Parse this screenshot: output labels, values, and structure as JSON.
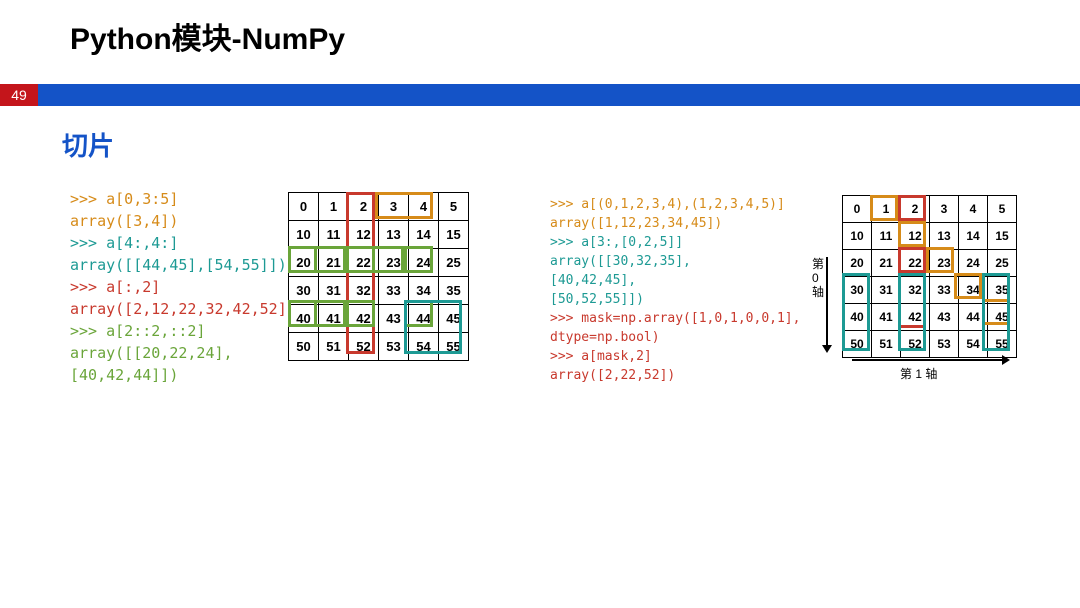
{
  "page_number": "49",
  "title": "Python模块-NumPy",
  "subtitle": "切片",
  "codeL": {
    "l1": ">>> a[0,3:5]",
    "l2": "array([3,4])",
    "l3": ">>> a[4:,4:]",
    "l4": "array([[44,45],[54,55]])",
    "l5": ">>> a[:,2]",
    "l6": "array([2,12,22,32,42,52])",
    "l7": ">>> a[2::2,::2]",
    "l8": "array([[20,22,24],",
    "l9": "       [40,42,44]])"
  },
  "codeR": {
    "l1": ">>> a[(0,1,2,3,4),(1,2,3,4,5)]",
    "l2": "array([1,12,23,34,45])",
    "l3": ">>> a[3:,[0,2,5]]",
    "l4": "array([[30,32,35],",
    "l5": "       [40,42,45],",
    "l6": "       [50,52,55]])",
    "l7": ">>> mask=np.array([1,0,1,0,0,1],",
    "l8": "                dtype=np.bool)",
    "l9": ">>> a[mask,2]",
    "l10": "array([2,22,52])"
  },
  "grid": {
    "r0": [
      "0",
      "1",
      "2",
      "3",
      "4",
      "5"
    ],
    "r1": [
      "10",
      "11",
      "12",
      "13",
      "14",
      "15"
    ],
    "r2": [
      "20",
      "21",
      "22",
      "23",
      "24",
      "25"
    ],
    "r3": [
      "30",
      "31",
      "32",
      "33",
      "34",
      "35"
    ],
    "r4": [
      "40",
      "41",
      "42",
      "43",
      "44",
      "45"
    ],
    "r5": [
      "50",
      "51",
      "52",
      "53",
      "54",
      "55"
    ]
  },
  "axis": {
    "v1": "第",
    "v2": "0",
    "v3": "轴",
    "h": "第 1 轴"
  }
}
